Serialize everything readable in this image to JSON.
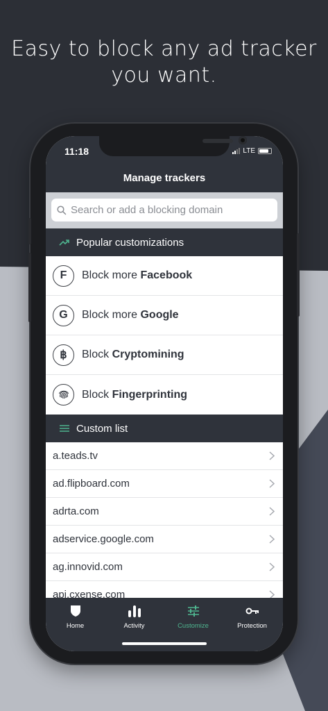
{
  "headline": {
    "line1": "Easy to block any ad tracker",
    "line2": "you want."
  },
  "status_bar": {
    "time": "11:18",
    "network": "LTE"
  },
  "screen_title": "Manage trackers",
  "search": {
    "placeholder": "Search or add a blocking domain"
  },
  "popular": {
    "label": "Popular customizations",
    "items": [
      {
        "icon_letter": "F",
        "icon": "facebook-icon",
        "prefix": "Block more ",
        "bold": "Facebook"
      },
      {
        "icon_letter": "G",
        "icon": "google-icon",
        "prefix": "Block more ",
        "bold": "Google"
      },
      {
        "icon_letter": "฿",
        "icon": "bitcoin-icon",
        "prefix": "Block ",
        "bold": "Cryptomining"
      },
      {
        "icon_letter": "",
        "icon": "fingerprint-icon",
        "prefix": "Block ",
        "bold": "Fingerprinting"
      }
    ]
  },
  "custom": {
    "label": "Custom list",
    "domains": [
      "a.teads.tv",
      "ad.flipboard.com",
      "adrta.com",
      "adservice.google.com",
      "ag.innovid.com",
      "api.cxense.com"
    ]
  },
  "tabs": [
    {
      "label": "Home",
      "icon": "shield-icon"
    },
    {
      "label": "Activity",
      "icon": "bar-chart-icon"
    },
    {
      "label": "Customize",
      "icon": "sliders-icon"
    },
    {
      "label": "Protection",
      "icon": "key-icon"
    }
  ],
  "colors": {
    "dark": "#2c2f36",
    "panel": "#2f333b",
    "accent": "#4fb690",
    "light_bg": "#b9bcc3"
  }
}
